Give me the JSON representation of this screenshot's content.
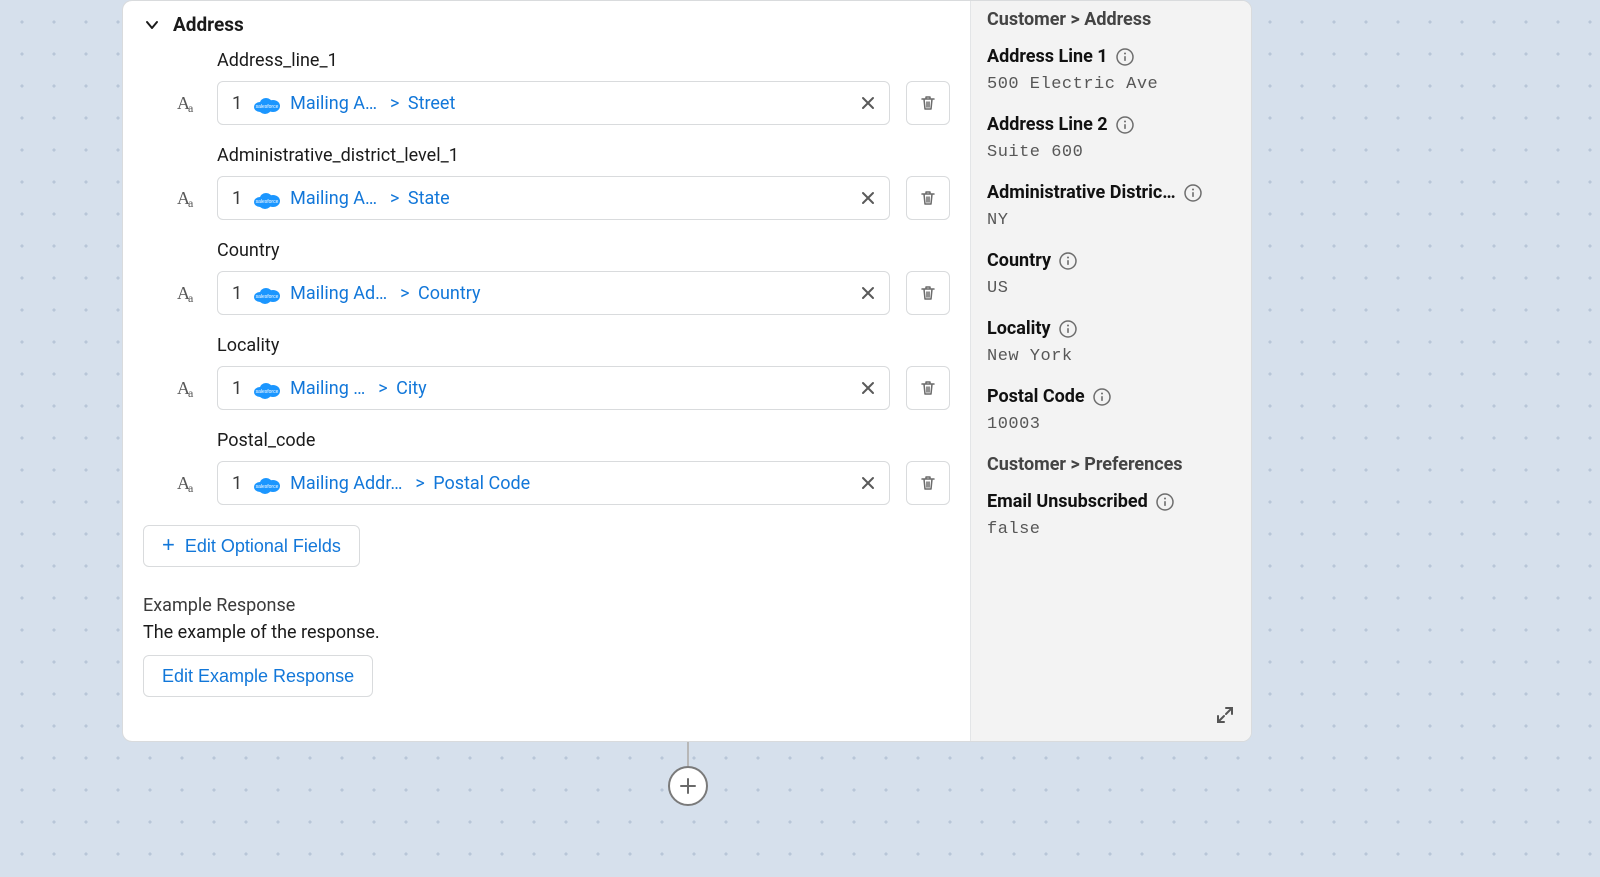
{
  "section": {
    "title": "Address"
  },
  "fields": [
    {
      "label": "Address_line_1",
      "idx": "1",
      "mapping_left": "Mailing A…",
      "mapping_right": "Street"
    },
    {
      "label": "Administrative_district_level_1",
      "idx": "1",
      "mapping_left": "Mailing A…",
      "mapping_right": "State"
    },
    {
      "label": "Country",
      "idx": "1",
      "mapping_left": "Mailing Ad…",
      "mapping_right": "Country"
    },
    {
      "label": "Locality",
      "idx": "1",
      "mapping_left": "Mailing …",
      "mapping_right": "City"
    },
    {
      "label": "Postal_code",
      "idx": "1",
      "mapping_left": "Mailing Addr…",
      "mapping_right": "Postal Code"
    }
  ],
  "buttons": {
    "edit_optional": "Edit Optional Fields",
    "edit_example": "Edit Example Response"
  },
  "example": {
    "title": "Example Response",
    "desc": "The example of the response."
  },
  "right": {
    "breadcrumb1": "Customer > Address",
    "items": [
      {
        "label": "Address Line 1",
        "value": "500 Electric Ave"
      },
      {
        "label": "Address Line 2",
        "value": "Suite 600"
      },
      {
        "label": "Administrative Distric…",
        "value": "NY"
      },
      {
        "label": "Country",
        "value": "US"
      },
      {
        "label": "Locality",
        "value": "New York"
      },
      {
        "label": "Postal Code",
        "value": "10003"
      }
    ],
    "breadcrumb2": "Customer > Preferences",
    "items2": [
      {
        "label": "Email Unsubscribed",
        "value": "false"
      }
    ]
  }
}
